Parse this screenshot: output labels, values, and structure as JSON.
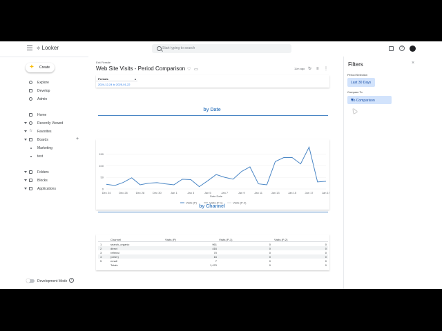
{
  "app": {
    "logo_text": "Looker"
  },
  "search": {
    "placeholder": "Start typing to search"
  },
  "nav": {
    "create_label": "Create",
    "items": [
      {
        "label": "Explore"
      },
      {
        "label": "Develop"
      },
      {
        "label": "Admin"
      },
      {
        "label": "Home"
      },
      {
        "label": "Recently Viewed"
      },
      {
        "label": "Favorites"
      },
      {
        "label": "Boards"
      },
      {
        "label": "Marketing"
      },
      {
        "label": "test"
      },
      {
        "label": "Folders"
      },
      {
        "label": "Blocks"
      },
      {
        "label": "Applications"
      }
    ],
    "dev_mode_label": "Development Mode"
  },
  "dashboard": {
    "breadcrumb": "Exit Firestte",
    "title": "Web Site Visits - Period Comparison",
    "updated": "11m ago",
    "periods_header": "Periods",
    "periods_value": "2024-12-24 to 2025-01-22",
    "section_date": "by Date",
    "section_channel": "by Channel"
  },
  "chart_data": {
    "type": "line",
    "x": [
      "Dec 24",
      "Dec 25",
      "Dec 26",
      "Dec 27",
      "Dec 28",
      "Dec 29",
      "Dec 30",
      "Dec 31",
      "Jan 1",
      "Jan 2",
      "Jan 3",
      "Jan 4",
      "Jan 5",
      "Jan 6",
      "Jan 7",
      "Jan 8",
      "Jan 9",
      "Jan 10",
      "Jan 11",
      "Jan 12",
      "Jan 13",
      "Jan 14",
      "Jan 15",
      "Jan 16",
      "Jan 17",
      "Jan 18",
      "Jan 19"
    ],
    "x_tick_labels": [
      "Dec 24",
      "Dec 26",
      "Dec 28",
      "Dec 30",
      "Jan 1",
      "Jan 3",
      "Jan 5",
      "Jan 7",
      "Jan 9",
      "Jan 11",
      "Jan 13",
      "Jan 15",
      "Jan 17",
      "Jan 19"
    ],
    "series": [
      {
        "name": "Visits (P)",
        "color": "#4a86c5",
        "values": [
          20,
          15,
          28,
          48,
          18,
          25,
          27,
          22,
          18,
          42,
          40,
          10,
          35,
          62,
          50,
          42,
          75,
          95,
          22,
          18,
          118,
          135,
          135,
          108,
          180,
          30,
          33
        ]
      },
      {
        "name": "Visits (P-1)",
        "color": "#9aa0a6",
        "values": []
      },
      {
        "name": "Visits (P-2)",
        "color": "#dadce0",
        "values": []
      }
    ],
    "xlabel": "Date Date",
    "ylabel": "",
    "y_ticks": [
      0,
      50,
      100,
      150
    ],
    "ylim": [
      0,
      190
    ],
    "grid": true,
    "legend": "bottom"
  },
  "channel_table": {
    "headers": [
      "",
      "Channel",
      "Visits (P)",
      "Visits (P-1)",
      "Visits (P-2)"
    ],
    "rows": [
      [
        "1",
        "search_organic",
        "961",
        "0",
        "0"
      ],
      [
        "2",
        "direct",
        "416",
        "0",
        "0"
      ],
      [
        "3",
        "referral",
        "70",
        "0",
        "0"
      ],
      [
        "4",
        "(other)",
        "16",
        "0",
        "0"
      ],
      [
        "5",
        "email",
        "7",
        "0",
        "0"
      ]
    ],
    "totals": [
      "Totals",
      "",
      "1,470",
      "0",
      "0"
    ]
  },
  "filters": {
    "title": "Filters",
    "period_label": "Period Selection",
    "period_value": "Last 30 Days",
    "compare_label": "Compare To",
    "compare_value": "No Comparison"
  }
}
